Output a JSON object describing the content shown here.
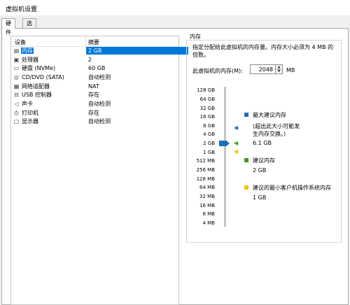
{
  "window": {
    "title": "虚拟机设置"
  },
  "tabs": [
    {
      "label": "硬件"
    },
    {
      "label": "选项"
    }
  ],
  "device_list": {
    "headers": {
      "device": "设备",
      "summary": "摘要"
    },
    "rows": [
      {
        "icon": "memory-icon",
        "name": "内存",
        "summary": "2 GB"
      },
      {
        "icon": "cpu-icon",
        "name": "处理器",
        "summary": "2"
      },
      {
        "icon": "disk-icon",
        "name": "硬盘 (NVMe)",
        "summary": "60 GB"
      },
      {
        "icon": "cdrom-icon",
        "name": "CD/DVD (SATA)",
        "summary": "自动检测"
      },
      {
        "icon": "network-icon",
        "name": "网络适配器",
        "summary": "NAT"
      },
      {
        "icon": "usb-icon",
        "name": "USB 控制器",
        "summary": "存在"
      },
      {
        "icon": "sound-icon",
        "name": "声卡",
        "summary": "自动检测"
      },
      {
        "icon": "printer-icon",
        "name": "打印机",
        "summary": "存在"
      },
      {
        "icon": "display-icon",
        "name": "显示器",
        "summary": "自动检测"
      }
    ]
  },
  "memory": {
    "section_title": "内存",
    "description": "指定分配给此虚拟机的内存量。内存大小必须为 4 MB 的倍数。",
    "field_label": "此虚拟机的内存(M):",
    "value": "2048",
    "unit": "MB",
    "scale": [
      "128 GB",
      "64 GB",
      "32 GB",
      "16 GB",
      "8 GB",
      "4 GB",
      "2 GB",
      "1 GB",
      "512 MB",
      "256 MB",
      "128 MB",
      "64 MB",
      "32 MB",
      "16 MB",
      "8 MB",
      "4 MB"
    ],
    "legend": {
      "max": {
        "title": "最大建议内存",
        "note": "(超出此大小可能发生内存交换。)",
        "value": "6.1 GB",
        "color": "#1f6fb2"
      },
      "recommended": {
        "title": "建议内存",
        "value": "2 GB",
        "color": "#3a9a1e"
      },
      "min": {
        "title": "建议的最小客户机操作系统内存",
        "value": "1 GB",
        "color": "#f2c200"
      }
    }
  }
}
